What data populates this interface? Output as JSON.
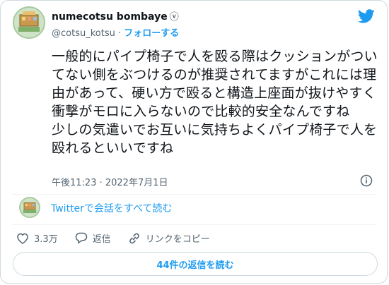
{
  "author": {
    "name": "numecotsu bombaye",
    "verified_glyph": "ⓥ",
    "handle": "@cotsu_kotsu",
    "separator": "·",
    "follow_label": "フォローする"
  },
  "tweet": {
    "text": "一般的にパイプ椅子で人を殴る際はクッションがついてない側をぶつけるのが推奨されてますがこれには理由があって、硬い方で殴ると構造上座面が抜けやすく衝撃がモロに入らないので比較的安全なんですね\n少しの気遣いでお互いに気持ちよくパイプ椅子で人を殴れるといいですね",
    "timestamp": "午後11:23 · 2022年7月1日"
  },
  "conversation": {
    "read_label": "Twitterで会話をすべて読む"
  },
  "actions": {
    "likes": "3.3万",
    "reply_label": "返信",
    "copy_link_label": "リンクをコピー"
  },
  "footer": {
    "read_replies_label": "44件の返信を読む"
  },
  "icons": {
    "brand": "twitter-bird-icon",
    "info": "info-icon",
    "like": "heart-icon",
    "reply": "reply-bubble-icon",
    "copy": "link-icon"
  },
  "colors": {
    "accent": "#1d9bf0",
    "text": "#0f1419",
    "muted": "#536471",
    "border": "#cfd9de"
  }
}
